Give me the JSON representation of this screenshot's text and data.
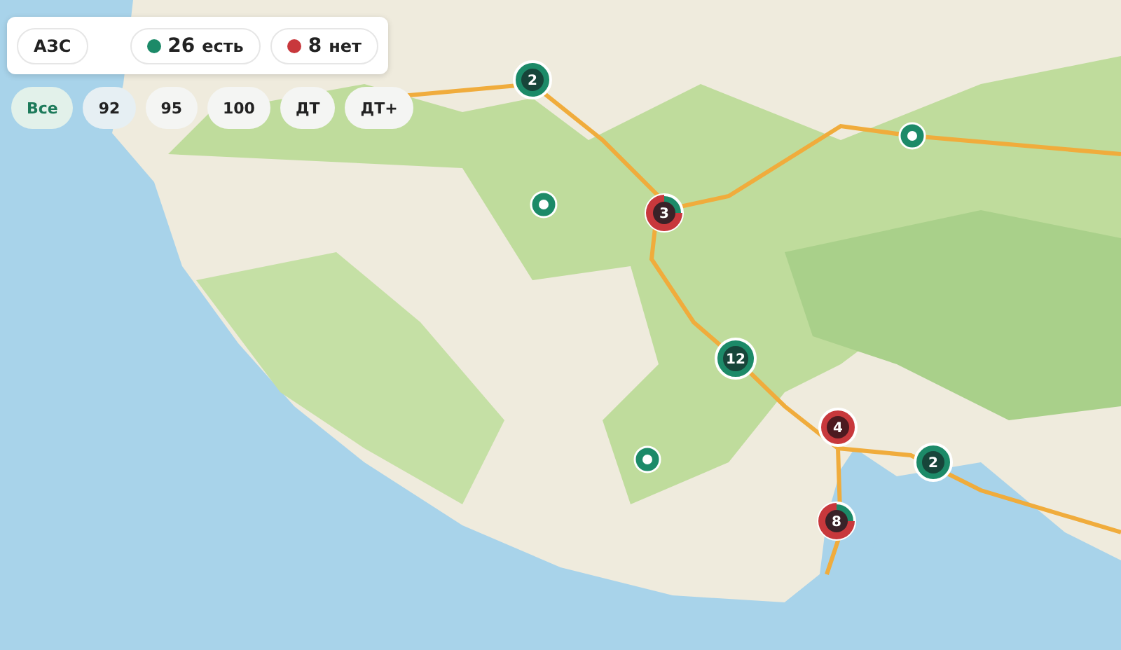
{
  "panel": {
    "title": "АЗС",
    "available": {
      "count": "26",
      "label": "есть",
      "color": "#1c8a68"
    },
    "unavailable": {
      "count": "8",
      "label": "нет",
      "color": "#c8383c"
    }
  },
  "fuel_filters": [
    {
      "label": "Все",
      "selected": true,
      "highlighted": false
    },
    {
      "label": "92",
      "selected": false,
      "highlighted": true
    },
    {
      "label": "95",
      "selected": false,
      "highlighted": false
    },
    {
      "label": "100",
      "selected": false,
      "highlighted": false
    },
    {
      "label": "ДТ",
      "selected": false,
      "highlighted": false
    },
    {
      "label": "ДТ+",
      "selected": false,
      "highlighted": false
    }
  ],
  "markers": [
    {
      "kind": "cluster",
      "has_available": true,
      "has_unavailable": false,
      "count": "2"
    },
    {
      "kind": "single",
      "has_available": true,
      "has_unavailable": false
    },
    {
      "kind": "cluster",
      "has_available": true,
      "has_unavailable": true,
      "count": "3"
    },
    {
      "kind": "single",
      "has_available": true,
      "has_unavailable": false
    },
    {
      "kind": "cluster",
      "has_available": true,
      "has_unavailable": false,
      "count": "12"
    },
    {
      "kind": "cluster",
      "has_available": false,
      "has_unavailable": true,
      "count": "4"
    },
    {
      "kind": "single",
      "has_available": true,
      "has_unavailable": false
    },
    {
      "kind": "cluster",
      "has_available": true,
      "has_unavailable": false,
      "count": "2"
    },
    {
      "kind": "cluster",
      "has_available": true,
      "has_unavailable": true,
      "count": "8"
    }
  ]
}
